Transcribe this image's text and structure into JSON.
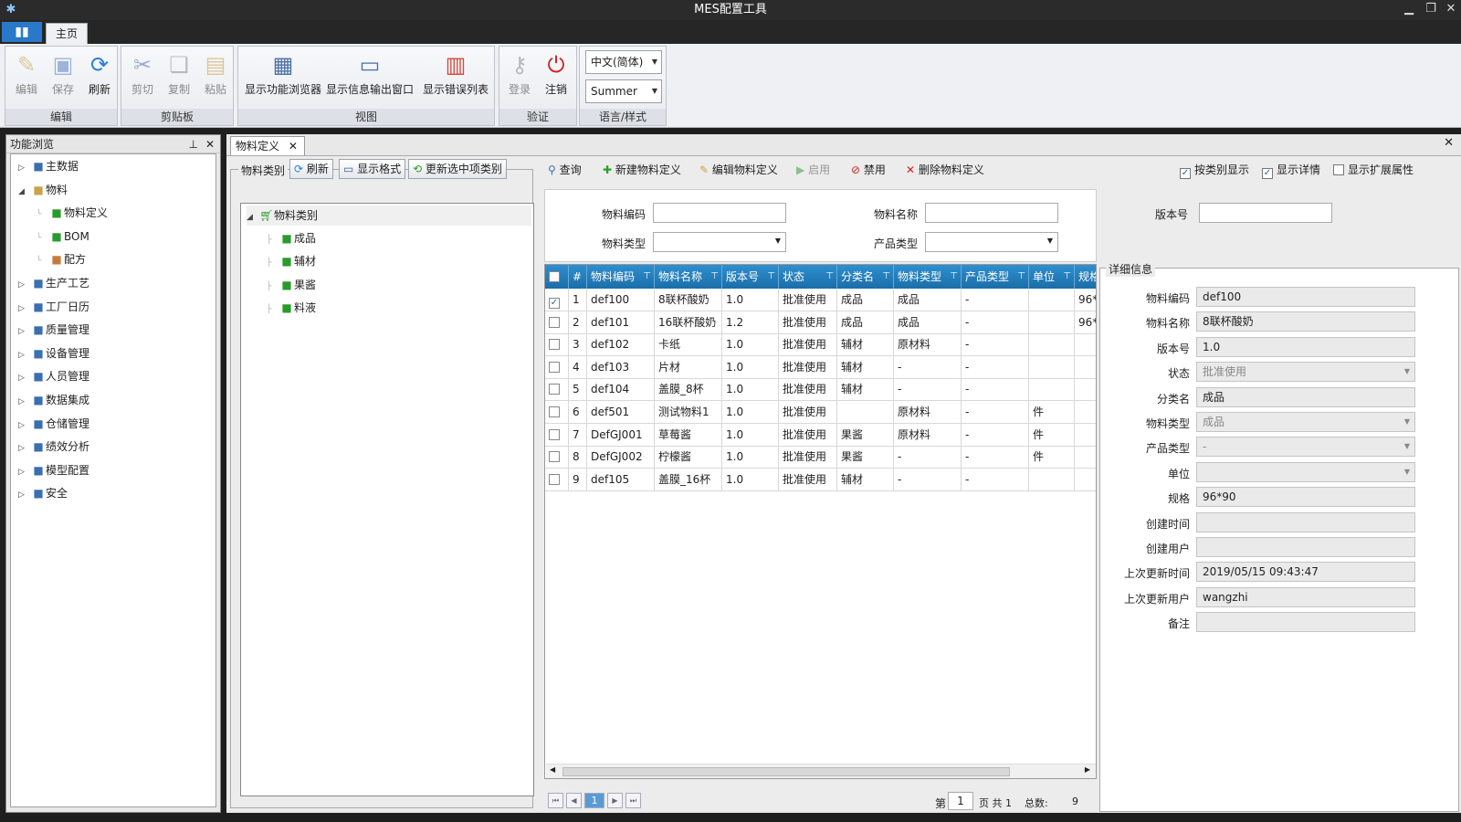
{
  "window": {
    "title": "MES配置工具"
  },
  "ribbon": {
    "home_tab": "主页",
    "groups": {
      "edit": {
        "label": "编辑",
        "buttons": [
          "编辑",
          "保存",
          "刷新"
        ]
      },
      "clipboard": {
        "label": "剪贴板",
        "buttons": [
          "剪切",
          "复制",
          "粘贴"
        ]
      },
      "view": {
        "label": "视图",
        "buttons": [
          "显示功能浏览器",
          "显示信息输出窗口",
          "显示错误列表"
        ]
      },
      "auth": {
        "label": "验证",
        "buttons": [
          "登录",
          "注销"
        ]
      },
      "lang": {
        "label": "语言/样式",
        "language": "中文(简体)",
        "style": "Summer"
      }
    }
  },
  "function_browser": {
    "title": "功能浏览",
    "items": [
      {
        "label": "主数据",
        "icon": "master-data-icon",
        "expanded": false
      },
      {
        "label": "物料",
        "icon": "folder-icon",
        "expanded": true
      },
      {
        "label": "物料定义",
        "icon": "cart-icon",
        "child": true
      },
      {
        "label": "BOM",
        "icon": "flask-icon",
        "child": true
      },
      {
        "label": "配方",
        "icon": "recipe-icon",
        "child": true
      },
      {
        "label": "生产工艺",
        "icon": "process-icon",
        "expanded": false
      },
      {
        "label": "工厂日历",
        "icon": "calendar-icon",
        "expanded": false
      },
      {
        "label": "质量管理",
        "icon": "quality-icon",
        "expanded": false
      },
      {
        "label": "设备管理",
        "icon": "equipment-icon",
        "expanded": false
      },
      {
        "label": "人员管理",
        "icon": "people-icon",
        "expanded": false
      },
      {
        "label": "数据集成",
        "icon": "integration-icon",
        "expanded": false
      },
      {
        "label": "仓储管理",
        "icon": "warehouse-icon",
        "expanded": false
      },
      {
        "label": "绩效分析",
        "icon": "analysis-icon",
        "expanded": false
      },
      {
        "label": "模型配置",
        "icon": "model-icon",
        "expanded": false
      },
      {
        "label": "安全",
        "icon": "security-icon",
        "expanded": false
      }
    ]
  },
  "document": {
    "tab": "物料定义",
    "category": {
      "label": "物料类别",
      "buttons": {
        "refresh": "刷新",
        "format": "显示格式",
        "update": "更新选中项类别"
      },
      "root": "物料类别",
      "children": [
        "成品",
        "辅材",
        "果酱",
        "料液"
      ]
    },
    "toolbar": {
      "query": "查询",
      "new": "新建物料定义",
      "edit": "编辑物料定义",
      "enable": "启用",
      "disable": "禁用",
      "delete": "删除物料定义",
      "by_category": "按类别显示",
      "show_detail": "显示详情",
      "show_ext": "显示扩展属性"
    },
    "search": {
      "code": "物料编码",
      "name": "物料名称",
      "version": "版本号",
      "type": "物料类型",
      "product_type": "产品类型"
    },
    "grid": {
      "columns": [
        "#",
        "物料编码",
        "物料名称",
        "版本号",
        "状态",
        "分类名",
        "物料类型",
        "产品类型",
        "单位",
        "规格"
      ],
      "rows": [
        {
          "n": "1",
          "code": "def100",
          "name": "8联杯酸奶",
          "ver": "1.0",
          "status": "批准使用",
          "cat": "成品",
          "type": "成品",
          "ptype": "-",
          "unit": "",
          "spec": "96*",
          "checked": true
        },
        {
          "n": "2",
          "code": "def101",
          "name": "16联杯酸奶",
          "ver": "1.2",
          "status": "批准使用",
          "cat": "成品",
          "type": "成品",
          "ptype": "-",
          "unit": "",
          "spec": "96*",
          "checked": false
        },
        {
          "n": "3",
          "code": "def102",
          "name": "卡纸",
          "ver": "1.0",
          "status": "批准使用",
          "cat": "辅材",
          "type": "原材料",
          "ptype": "-",
          "unit": "",
          "spec": "",
          "checked": false
        },
        {
          "n": "4",
          "code": "def103",
          "name": "片材",
          "ver": "1.0",
          "status": "批准使用",
          "cat": "辅材",
          "type": "-",
          "ptype": "-",
          "unit": "",
          "spec": "",
          "checked": false
        },
        {
          "n": "5",
          "code": "def104",
          "name": "盖膜_8杯",
          "ver": "1.0",
          "status": "批准使用",
          "cat": "辅材",
          "type": "-",
          "ptype": "-",
          "unit": "",
          "spec": "",
          "checked": false
        },
        {
          "n": "6",
          "code": "def501",
          "name": "测试物料1",
          "ver": "1.0",
          "status": "批准使用",
          "cat": "",
          "type": "原材料",
          "ptype": "-",
          "unit": "件",
          "spec": "",
          "checked": false
        },
        {
          "n": "7",
          "code": "DefGJ001",
          "name": "草莓酱",
          "ver": "1.0",
          "status": "批准使用",
          "cat": "果酱",
          "type": "原材料",
          "ptype": "-",
          "unit": "件",
          "spec": "",
          "checked": false
        },
        {
          "n": "8",
          "code": "DefGJ002",
          "name": "柠檬酱",
          "ver": "1.0",
          "status": "批准使用",
          "cat": "果酱",
          "type": "-",
          "ptype": "-",
          "unit": "件",
          "spec": "",
          "checked": false
        },
        {
          "n": "9",
          "code": "def105",
          "name": "盖膜_16杯",
          "ver": "1.0",
          "status": "批准使用",
          "cat": "辅材",
          "type": "-",
          "ptype": "-",
          "unit": "",
          "spec": "",
          "checked": false
        }
      ]
    },
    "pager": {
      "page_label": "第",
      "page": "1",
      "of_label": "页 共 1",
      "total_label": "总数:",
      "total": "9",
      "current_page_button": "1"
    },
    "detail": {
      "legend": "详细信息",
      "fields": [
        {
          "label": "物料编码",
          "value": "def100"
        },
        {
          "label": "物料名称",
          "value": "8联杯酸奶"
        },
        {
          "label": "版本号",
          "value": "1.0"
        },
        {
          "label": "状态",
          "value": "批准使用",
          "dropdown": true,
          "gray": true
        },
        {
          "label": "分类名",
          "value": "成品"
        },
        {
          "label": "物料类型",
          "value": "成品",
          "dropdown": true,
          "gray": true
        },
        {
          "label": "产品类型",
          "value": "-",
          "dropdown": true,
          "gray": true
        },
        {
          "label": "单位",
          "value": "",
          "dropdown": true
        },
        {
          "label": "规格",
          "value": "96*90"
        },
        {
          "label": "创建时间",
          "value": ""
        },
        {
          "label": "创建用户",
          "value": ""
        },
        {
          "label": "上次更新时间",
          "value": "2019/05/15 09:43:47"
        },
        {
          "label": "上次更新用户",
          "value": "wangzhi"
        },
        {
          "label": "备注",
          "value": ""
        }
      ]
    }
  }
}
